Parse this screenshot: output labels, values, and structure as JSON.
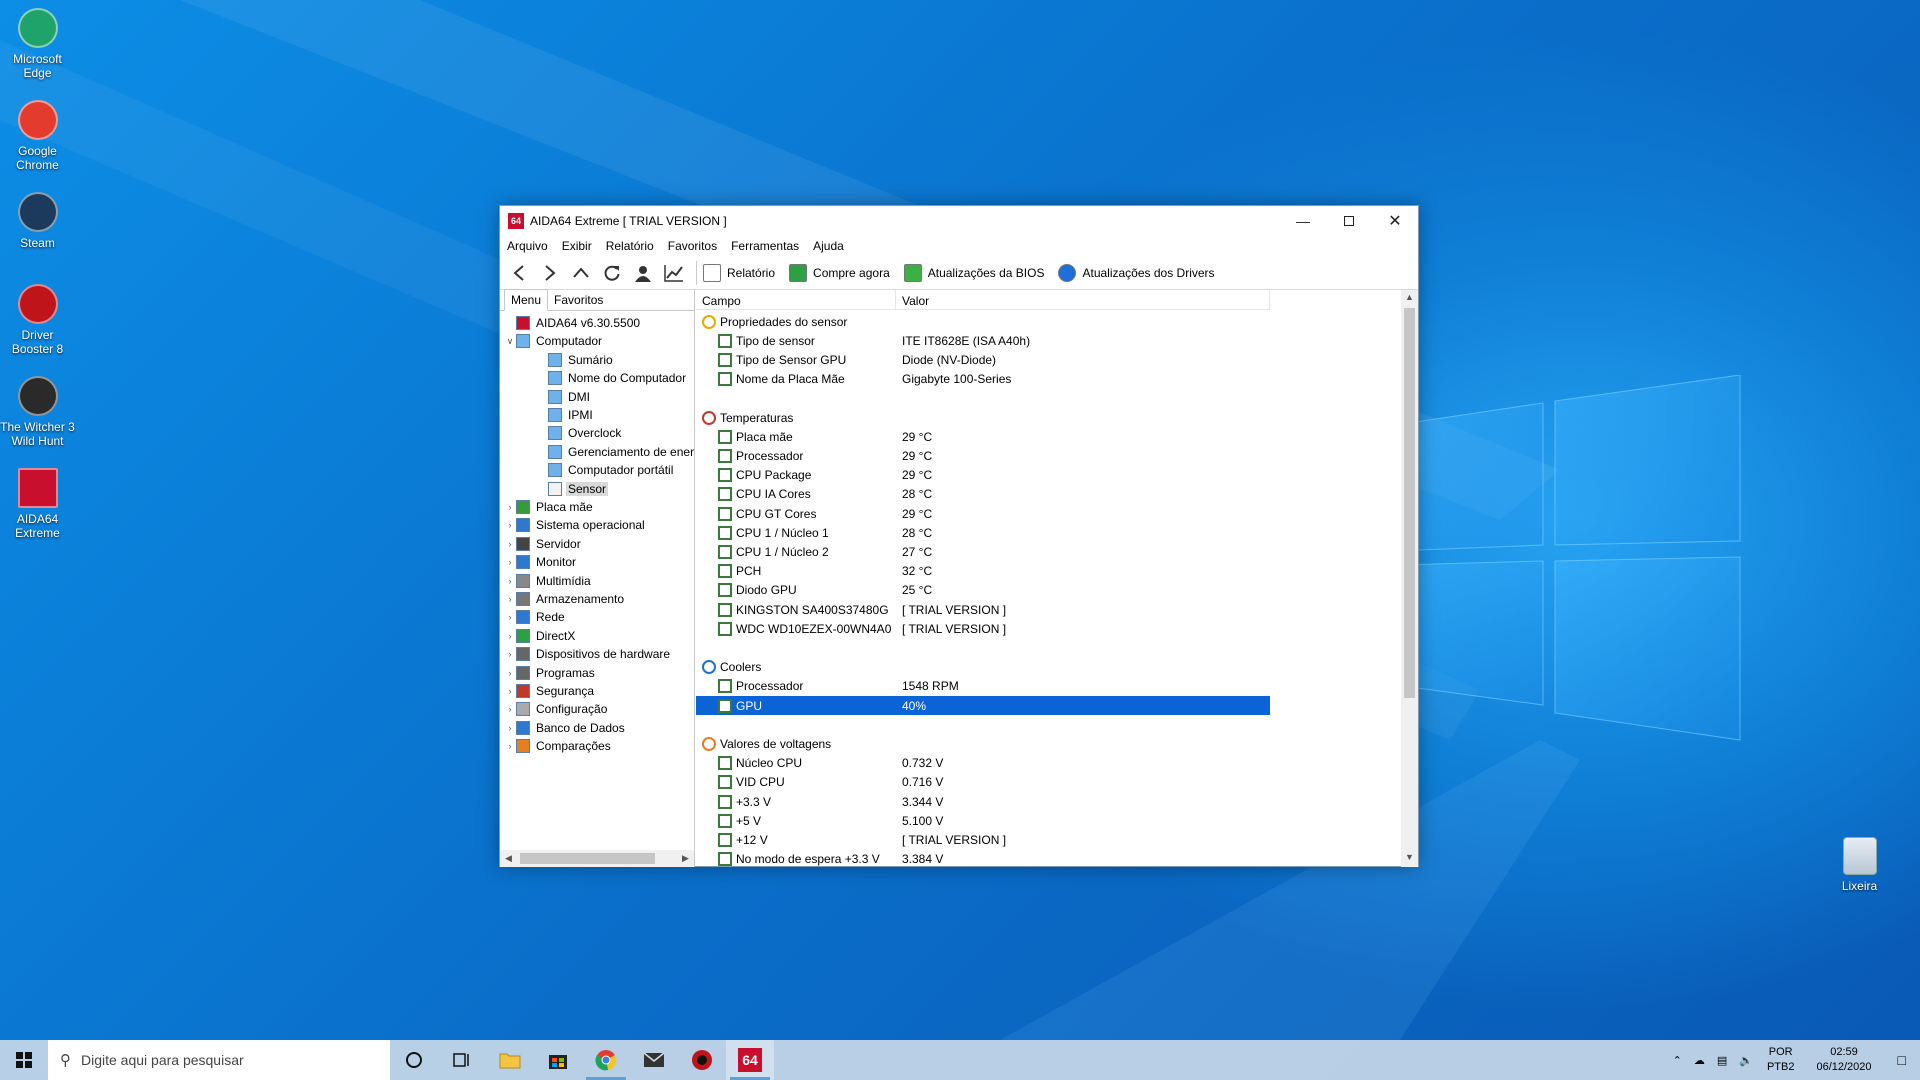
{
  "desktop": {
    "icons": [
      {
        "name": "edge",
        "label": "Microsoft Edge",
        "icon": "edge-icon",
        "color": "#1fa36b"
      },
      {
        "name": "chrome",
        "label": "Google Chrome",
        "icon": "chrome-icon",
        "color": "#e33b2e"
      },
      {
        "name": "steam",
        "label": "Steam",
        "icon": "steam-icon",
        "color": "#1b3a5c"
      },
      {
        "name": "driver-booster",
        "label": "Driver Booster 8",
        "icon": "driver-booster-icon",
        "color": "#c0141b"
      },
      {
        "name": "witcher",
        "label": "The Witcher 3 Wild Hunt",
        "icon": "witcher-icon",
        "color": "#2a2a2a"
      },
      {
        "name": "aida64",
        "label": "AIDA64 Extreme",
        "icon": "aida64-icon",
        "color": "#c8102e"
      }
    ],
    "recycle_bin": {
      "label": "Lixeira",
      "icon": "recycle-bin-icon"
    }
  },
  "window": {
    "app_icon_text": "64",
    "title": "AIDA64 Extreme  [ TRIAL VERSION ]",
    "menu": [
      "Arquivo",
      "Exibir",
      "Relatório",
      "Favoritos",
      "Ferramentas",
      "Ajuda"
    ],
    "toolbar": {
      "buttons": [
        {
          "label": "Relatório",
          "icon": "report-icon"
        },
        {
          "label": "Compre agora",
          "icon": "buy-now-icon"
        },
        {
          "label": "Atualizações da BIOS",
          "icon": "bios-update-icon"
        },
        {
          "label": "Atualizações dos Drivers",
          "icon": "driver-update-icon"
        }
      ]
    },
    "tabs": [
      "Menu",
      "Favoritos"
    ],
    "tree": {
      "root": "AIDA64 v6.30.5500",
      "computer": "Computador",
      "computer_children": [
        "Sumário",
        "Nome do Computador",
        "DMI",
        "IPMI",
        "Overclock",
        "Gerenciamento de ener",
        "Computador portátil",
        "Sensor"
      ],
      "selected": "Sensor",
      "groups": [
        "Placa mãe",
        "Sistema operacional",
        "Servidor",
        "Monitor",
        "Multimídia",
        "Armazenamento",
        "Rede",
        "DirectX",
        "Dispositivos de hardware",
        "Programas",
        "Segurança",
        "Configuração",
        "Banco de Dados",
        "Comparações"
      ]
    },
    "columns": {
      "field": "Campo",
      "value": "Valor"
    },
    "sections": [
      {
        "title": "Propriedades do sensor",
        "rows": [
          {
            "field": "Tipo de sensor",
            "value": "ITE IT8628E  (ISA A40h)"
          },
          {
            "field": "Tipo de Sensor GPU",
            "value": "Diode  (NV-Diode)"
          },
          {
            "field": "Nome da Placa Mãe",
            "value": "Gigabyte 100-Series"
          }
        ]
      },
      {
        "title": "Temperaturas",
        "rows": [
          {
            "field": "Placa mãe",
            "value": "29 °C"
          },
          {
            "field": "Processador",
            "value": "29 °C"
          },
          {
            "field": "CPU Package",
            "value": "29 °C"
          },
          {
            "field": "CPU IA Cores",
            "value": "28 °C"
          },
          {
            "field": "CPU GT Cores",
            "value": "29 °C"
          },
          {
            "field": "CPU 1 / Núcleo 1",
            "value": "28 °C"
          },
          {
            "field": "CPU 1 / Núcleo 2",
            "value": "27 °C"
          },
          {
            "field": "PCH",
            "value": "32 °C"
          },
          {
            "field": "Diodo GPU",
            "value": "25 °C"
          },
          {
            "field": "KINGSTON SA400S37480G",
            "value": "[ TRIAL VERSION ]"
          },
          {
            "field": "WDC WD10EZEX-00WN4A0",
            "value": "[ TRIAL VERSION ]"
          }
        ]
      },
      {
        "title": "Coolers",
        "rows": [
          {
            "field": "Processador",
            "value": "1548 RPM"
          },
          {
            "field": "GPU",
            "value": "40%",
            "selected": true
          }
        ]
      },
      {
        "title": "Valores de voltagens",
        "rows": [
          {
            "field": "Núcleo CPU",
            "value": "0.732 V"
          },
          {
            "field": "VID CPU",
            "value": "0.716 V"
          },
          {
            "field": "+3.3 V",
            "value": "3.344 V"
          },
          {
            "field": "+5 V",
            "value": "5.100 V"
          },
          {
            "field": "+12 V",
            "value": "[ TRIAL VERSION ]"
          },
          {
            "field": "No modo de espera +3.3 V",
            "value": "3.384 V"
          }
        ]
      }
    ]
  },
  "taskbar": {
    "search_placeholder": "Digite aqui para pesquisar",
    "lang_top": "POR",
    "lang_bottom": "PTB2",
    "time": "02:59",
    "date": "06/12/2020"
  }
}
